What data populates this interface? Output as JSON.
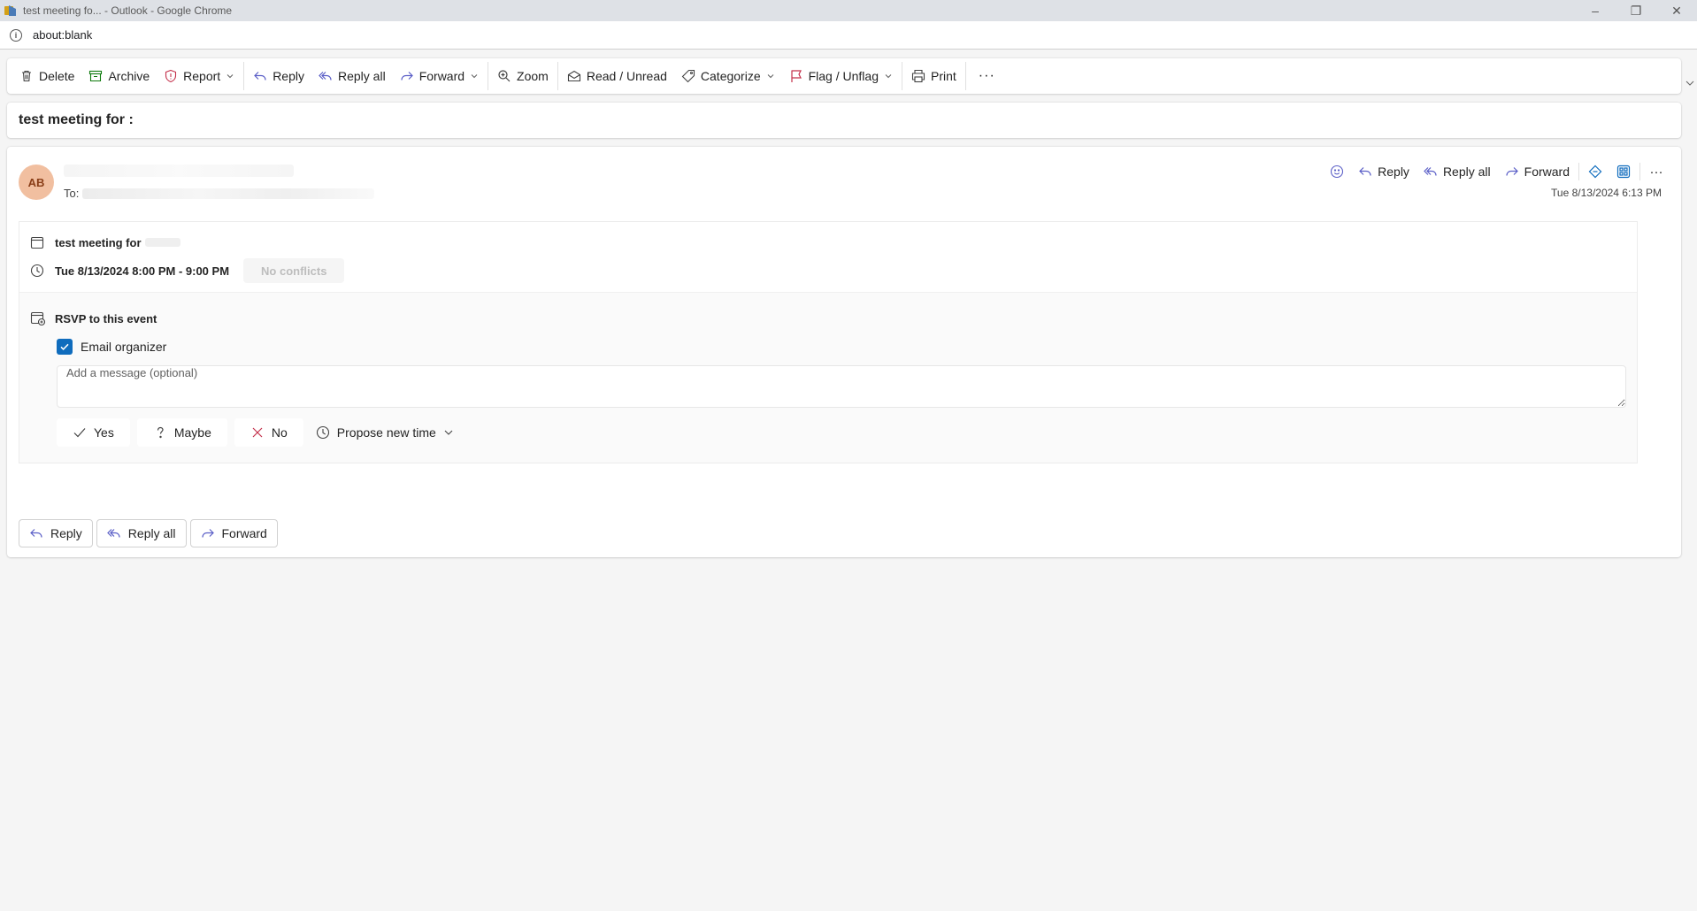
{
  "window": {
    "title": "test meeting fo... - Outlook - Google Chrome",
    "url": "about:blank"
  },
  "toolbar": {
    "delete": "Delete",
    "archive": "Archive",
    "report": "Report",
    "reply": "Reply",
    "reply_all": "Reply all",
    "forward": "Forward",
    "zoom": "Zoom",
    "read_unread": "Read / Unread",
    "categorize": "Categorize",
    "flag_unflag": "Flag / Unflag",
    "print": "Print",
    "more": "···"
  },
  "subject": "test meeting for :",
  "message": {
    "avatar_initials": "AB",
    "to_label": "To:",
    "timestamp": "Tue 8/13/2024 6:13 PM",
    "actions": {
      "reply": "Reply",
      "reply_all": "Reply all",
      "forward": "Forward",
      "more": "···"
    }
  },
  "meeting": {
    "title": "test meeting for",
    "time": "Tue 8/13/2024 8:00 PM - 9:00 PM",
    "conflicts": "No conflicts",
    "rsvp_title": "RSVP to this event",
    "email_organizer": "Email organizer",
    "email_organizer_checked": true,
    "message_placeholder": "Add a message (optional)",
    "responses": {
      "yes": "Yes",
      "maybe": "Maybe",
      "no": "No",
      "propose": "Propose new time"
    }
  },
  "bottom_actions": {
    "reply": "Reply",
    "reply_all": "Reply all",
    "forward": "Forward"
  },
  "colors": {
    "accent": "#0f6cbd",
    "avatar_bg": "#f1bfa0",
    "flag": "#c4314b"
  }
}
